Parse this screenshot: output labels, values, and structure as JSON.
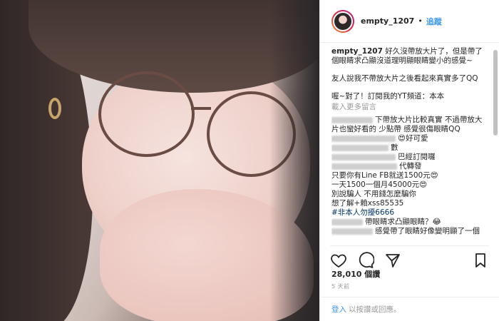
{
  "post": {
    "username": "empty_1207",
    "follow_label": "追蹤",
    "separator": "•",
    "caption_user": "empty_1207",
    "caption_text": "好久沒帶放大片了，但是帶了個眼睛求凸顯沒道理明顯眼睛變小的感覺~",
    "caption_p2": "友人說我不帶放大片之後看起來真實多了QQ",
    "caption_p3": "喔~對了！訂閱我的YT頻道：本本",
    "load_more": "載入更多留言",
    "comments": [
      "下帶放大片比較真實 不過帶放大",
      "片也蠻好看的 少點帶 感覺很傷眼睛QQ",
      "😍好可愛",
      "數",
      "巴經訂閱囉",
      "代轉發",
      "只要你有Line FB就送1500元😍",
      "一天1500一個月45000元😍",
      "別說騙人 不用錢怎麼騙你",
      "想了解+賴xss85535",
      "#非本人勿擾6666",
      "帶眼睛求凸顯眼睛？😂",
      "感覺帶了眼睛好像變明顯了一個"
    ],
    "likes": "28,010 個讚",
    "time_ago": "5 天前",
    "login_link": "登入",
    "login_text": "以按讚或回應。"
  },
  "icons": {
    "like": "heart-icon",
    "comment": "comment-icon",
    "share": "share-icon",
    "save": "bookmark-icon"
  }
}
